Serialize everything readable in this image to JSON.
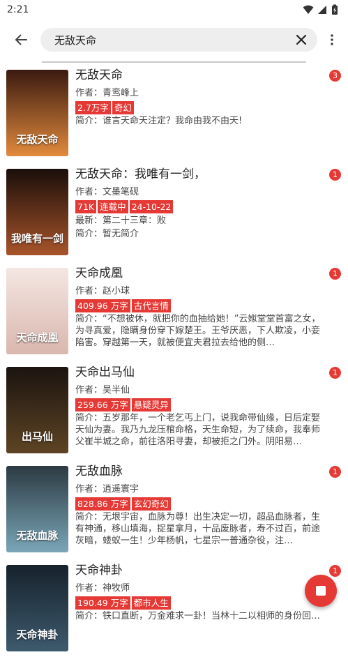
{
  "status": {
    "time": "2:21"
  },
  "search": {
    "query": "无敌天命"
  },
  "books": [
    {
      "title": "无敌天命",
      "author": "作者：青鸾峰上",
      "tags": [
        "2.7万字",
        "奇幻"
      ],
      "latest": "",
      "intro": "简介：谁言天命天注定？我命由我不由天!",
      "badge": "3",
      "cover": {
        "top": "#3a1a10",
        "bottom": "#e28a3c",
        "text": "无敌天命"
      }
    },
    {
      "title": "无敌天命：我唯有一剑，",
      "author": "作者：文墨笔砚",
      "tags": [
        "71K",
        "连载中",
        "24-10-22"
      ],
      "latest": "最新：第二十三章：败",
      "intro": "简介：暂无简介",
      "badge": "1",
      "cover": {
        "top": "#1a0e0a",
        "bottom": "#a8542a",
        "text": "我唯有一剑"
      }
    },
    {
      "title": "天命成凰",
      "author": "作者：赵小球",
      "tags": [
        "409.96 万字",
        "古代言情"
      ],
      "latest": "",
      "intro": "简介：“不想被休，就把你的血抽给她！”云娰堂堂首富之女，为寻真爱，隐瞒身份穿下嫁楚王。王爷厌恶，下人欺凌，小妾陷害。穿越第一天，就被便宜夫君拉去给他的侧…",
      "badge": "1",
      "cover": {
        "top": "#f4e6e2",
        "bottom": "#d9b7ae",
        "text": "天命成凰"
      }
    },
    {
      "title": "天命出马仙",
      "author": "作者：吴半仙",
      "tags": [
        "259.66 万字",
        "悬疑灵异"
      ],
      "latest": "",
      "intro": "简介：五岁那年，一个老乞丐上门，说我命带仙缘，日后定娶天仙为妻。我乃九龙压棺命格，天生命短，为了续命，我奉师父崔半城之命，前往洛阳寻妻，却被拒之门外。阴阳易…",
      "badge": "1",
      "cover": {
        "top": "#1b1410",
        "bottom": "#5e4424",
        "text": "出马仙"
      }
    },
    {
      "title": "无敌血脉",
      "author": "作者：逍遥寰宇",
      "tags": [
        "828.86 万字",
        "玄幻奇幻"
      ],
      "latest": "",
      "intro": "简介：无垠宇宙，血脉为尊！出生决定一切，超品血脉者，生有神通，移山填海，捉星拿月，十品废脉者，寿不过百，前途灰暗，蝼蚁一生！少年杨帆，七星宗一普通杂役，注…",
      "badge": "1",
      "cover": {
        "top": "#2c3a42",
        "bottom": "#7aa6b8",
        "text": "无敌血脉"
      }
    },
    {
      "title": "天命神卦",
      "author": "作者：神牧师",
      "tags": [
        "190.49 万字",
        "都市人生"
      ],
      "latest": "",
      "intro": "简介：铁口直断，万金难求一卦！当林十二以相师的身份回…",
      "badge": "1",
      "cover": {
        "top": "#16222c",
        "bottom": "#3e5a6e",
        "text": "天命神卦"
      }
    }
  ]
}
